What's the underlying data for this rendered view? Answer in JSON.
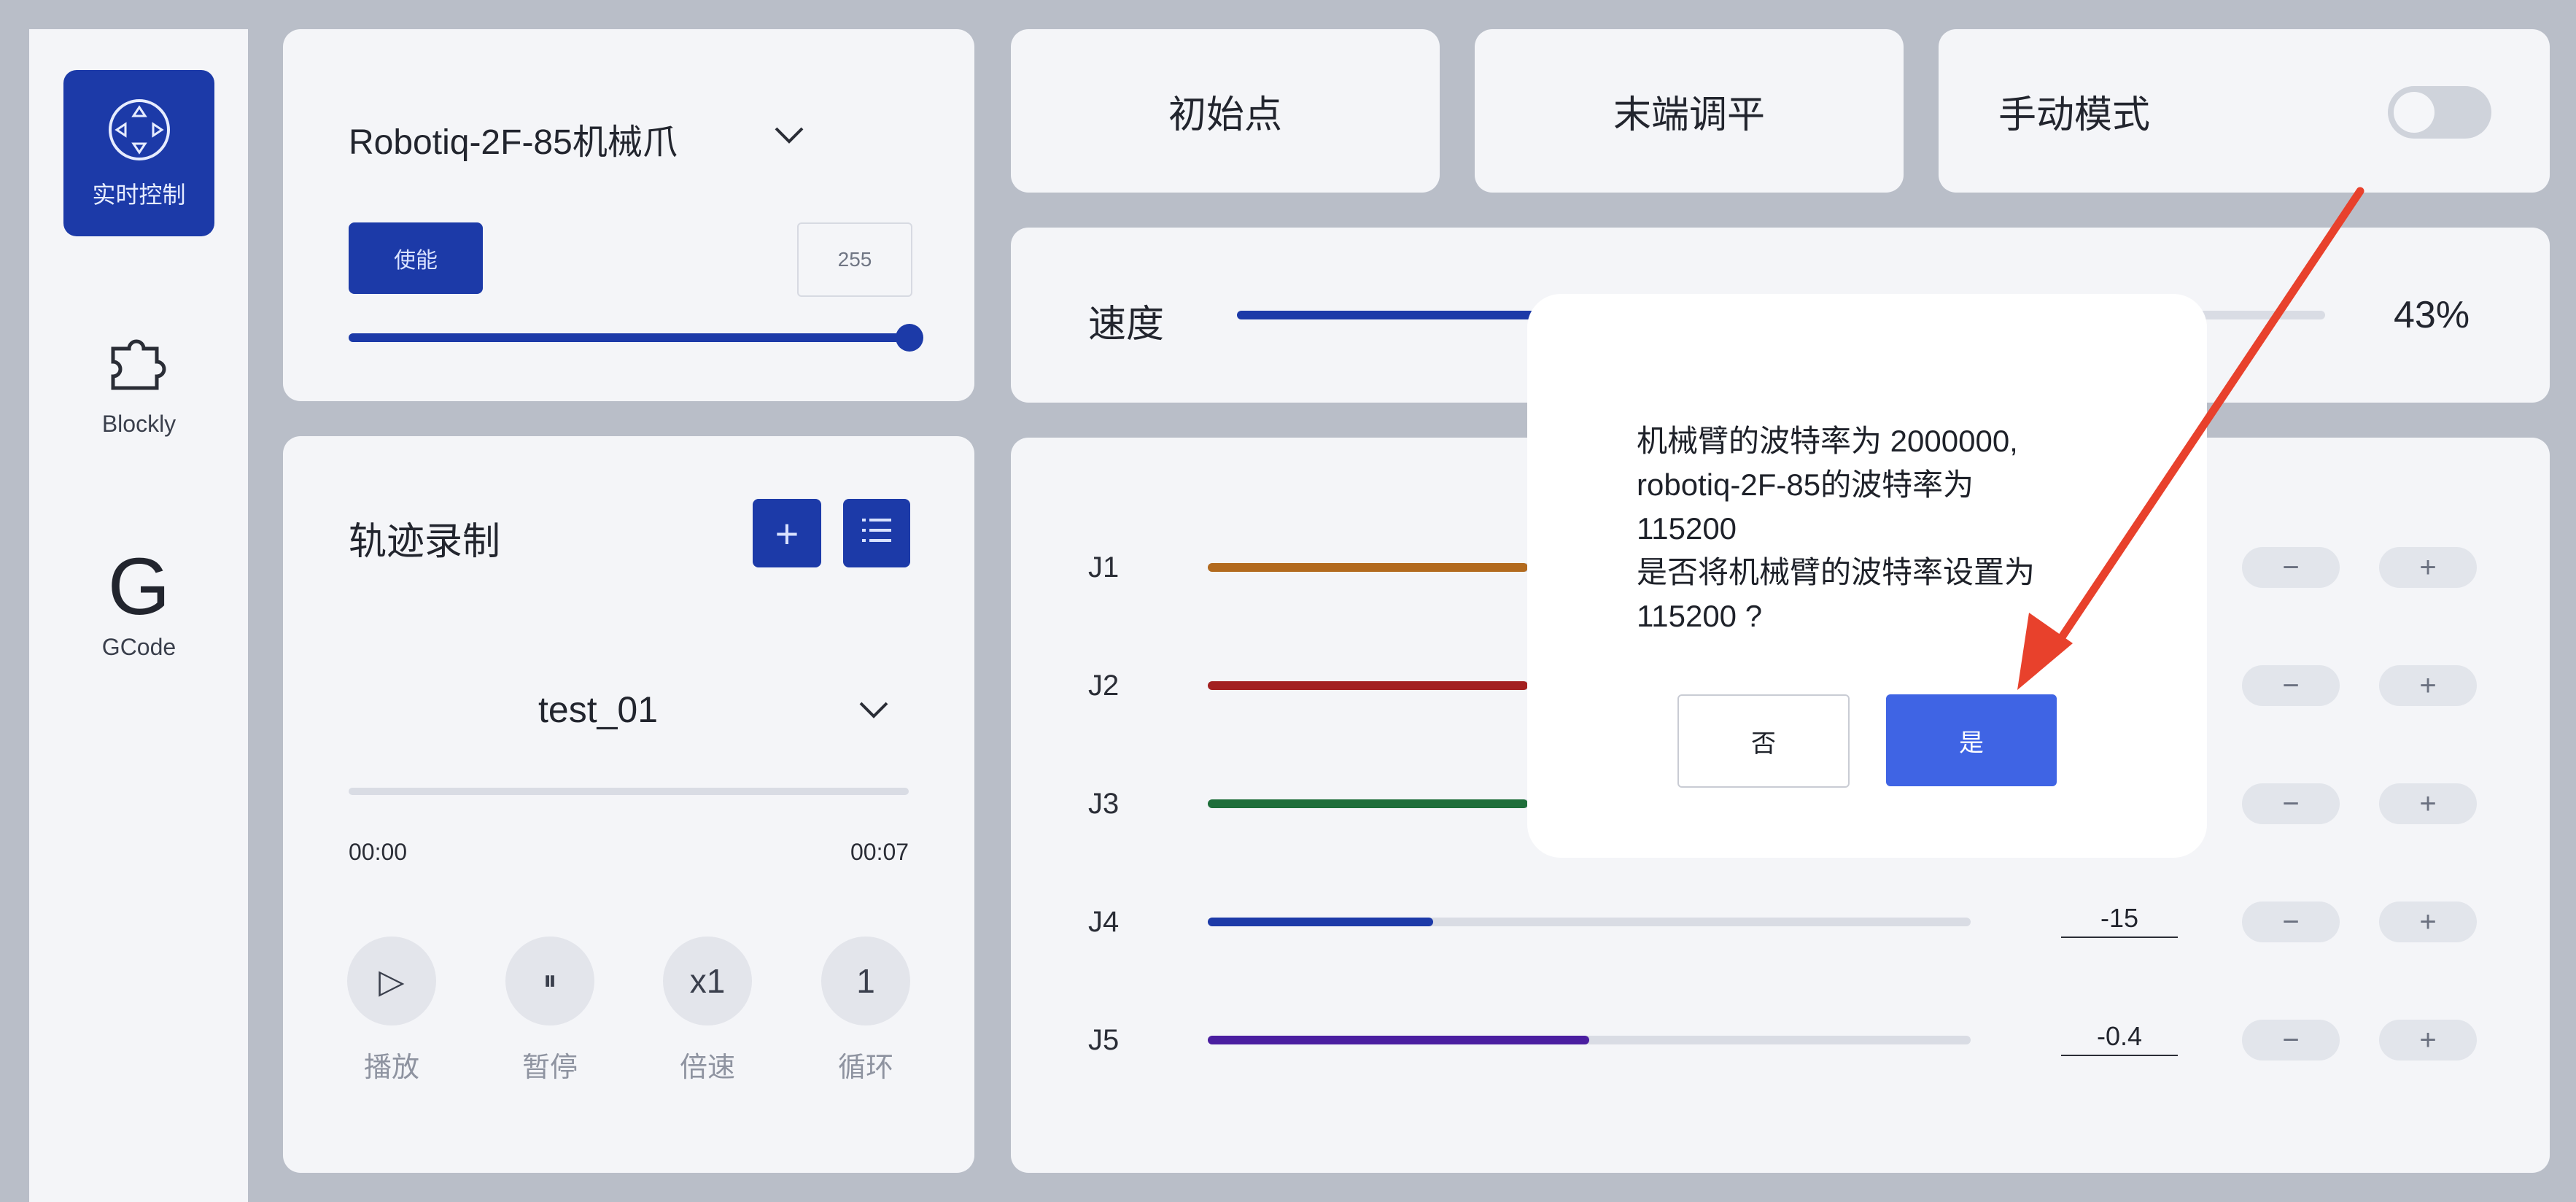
{
  "sidebar": {
    "items": [
      {
        "label": "实时控制",
        "icon": "joystick-icon",
        "active": true
      },
      {
        "label": "Blockly",
        "icon": "puzzle-icon",
        "active": false
      },
      {
        "label": "GCode",
        "icon": "gcode-icon",
        "active": false
      }
    ]
  },
  "gripper": {
    "title": "Robotiq-2F-85机械爪",
    "enable_label": "使能",
    "value": "255",
    "slider_fraction": 1.0
  },
  "trajectory": {
    "title": "轨迹录制",
    "selected": "test_01",
    "time_start": "00:00",
    "time_end": "00:07",
    "controls": [
      {
        "glyph": "▷",
        "label": "播放",
        "icon": "play-icon"
      },
      {
        "glyph": "⏸",
        "label": "暂停",
        "icon": "pause-icon"
      },
      {
        "glyph": "x1",
        "label": "倍速",
        "icon": "speed-icon"
      },
      {
        "glyph": "1",
        "label": "循环",
        "icon": "loop-icon"
      }
    ]
  },
  "top_buttons": {
    "home": "初始点",
    "level": "末端调平",
    "manual": "手动模式"
  },
  "speed": {
    "label": "速度",
    "value_text": "43%",
    "fraction": 0.43
  },
  "joints": [
    {
      "name": "J1",
      "color": "#b26a1e",
      "value": "",
      "fraction": 0.42
    },
    {
      "name": "J2",
      "color": "#a32020",
      "value": "",
      "fraction": 0.42
    },
    {
      "name": "J3",
      "color": "#1e6e3a",
      "value": "",
      "fraction": 0.42
    },
    {
      "name": "J4",
      "color": "#1c3aa8",
      "value": "-15",
      "fraction": 0.295
    },
    {
      "name": "J5",
      "color": "#4a1ea0",
      "value": "-0.4",
      "fraction": 0.5
    }
  ],
  "pm": {
    "minus": "−",
    "plus": "+"
  },
  "dialog": {
    "lines": [
      "机械臂的波特率为 2000000,",
      "robotiq-2F-85的波特率为",
      "115200",
      "是否将机械臂的波特率设置为",
      "115200 ?"
    ],
    "no": "否",
    "yes": "是"
  },
  "colors": {
    "accent": "#1c3aa8",
    "dialog_confirm": "#3f64e4",
    "annotation_arrow": "#e8412c"
  }
}
